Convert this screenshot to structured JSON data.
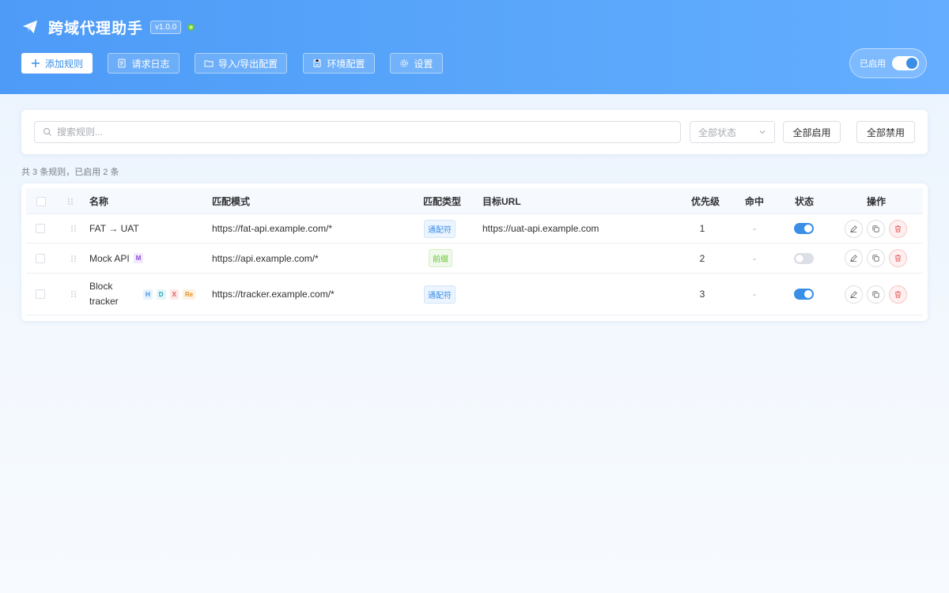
{
  "app": {
    "title": "跨域代理助手",
    "version": "v1.0.0",
    "status": "online"
  },
  "toolbar": {
    "add_rule": "添加规则",
    "request_log": "请求日志",
    "import_export": "导入/导出配置",
    "env_config": "环境配置",
    "settings": "设置"
  },
  "global_switch": {
    "label": "已启用",
    "enabled": true
  },
  "filter": {
    "search_placeholder": "搜索规则...",
    "search_value": "",
    "status_placeholder": "全部状态",
    "enable_all": "全部启用",
    "disable_all": "全部禁用"
  },
  "summary": "共 3 条规则，已启用 2 条",
  "table": {
    "headers": {
      "name": "名称",
      "pattern": "匹配模式",
      "match_type": "匹配类型",
      "target": "目标URL",
      "priority": "优先级",
      "hits": "命中",
      "status": "状态",
      "actions": "操作"
    },
    "rows": [
      {
        "name": "FAT → UAT",
        "badges": [],
        "pattern": "https://fat-api.example.com/*",
        "match_type": "通配符",
        "match_type_kind": "wildcard",
        "target": "https://uat-api.example.com",
        "priority": "1",
        "hits": "-",
        "enabled": true
      },
      {
        "name": "Mock API",
        "badges": [
          {
            "text": "M",
            "kind": "m"
          }
        ],
        "pattern": "https://api.example.com/*",
        "match_type": "前缀",
        "match_type_kind": "prefix",
        "target": "",
        "priority": "2",
        "hits": "-",
        "enabled": false
      },
      {
        "name_line1": "Block",
        "name_line2": "tracker",
        "badges": [
          {
            "text": "H",
            "kind": "h"
          },
          {
            "text": "D",
            "kind": "d"
          },
          {
            "text": "X",
            "kind": "x"
          },
          {
            "text": "Re",
            "kind": "re"
          }
        ],
        "pattern": "https://tracker.example.com/*",
        "match_type": "通配符",
        "match_type_kind": "wildcard",
        "target": "",
        "priority": "3",
        "hits": "-",
        "enabled": true
      }
    ]
  },
  "icons": {
    "logo": "paper-plane-icon",
    "search": "search-icon",
    "dropdown": "chevron-down-icon",
    "drag": "drag-handle-icon",
    "edit": "edit-icon",
    "copy": "copy-icon",
    "delete": "trash-icon"
  },
  "colors": {
    "primary": "#3a8ee6",
    "header_start": "#4d9bf7",
    "header_end": "#64adff",
    "success": "#67c23a",
    "danger": "#e45757"
  }
}
